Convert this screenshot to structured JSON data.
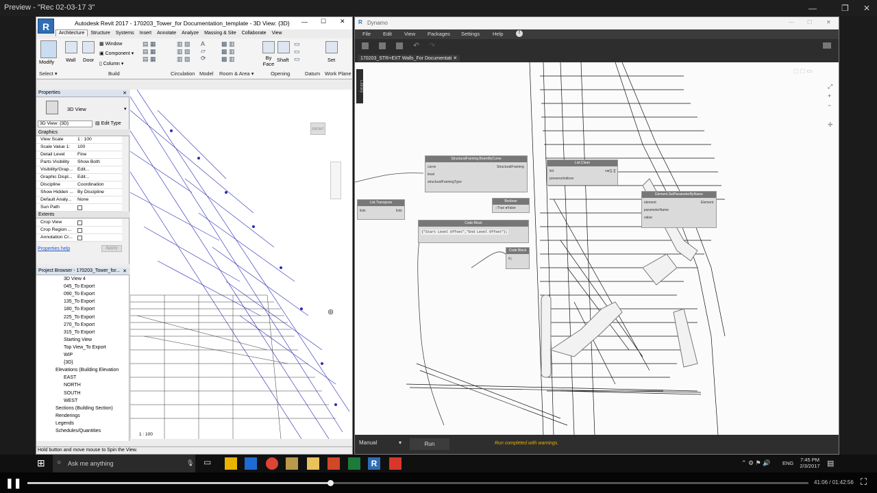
{
  "preview": {
    "title": "Preview - \"Rec 02-03-17 3\""
  },
  "revit": {
    "app_letter": "R",
    "title": "Autodesk Revit 2017 -     170203_Tower_for Documentation_template - 3D View: {3D}",
    "tabs": [
      "Architecture",
      "Structure",
      "Systems",
      "Insert",
      "Annotate",
      "Analyze",
      "Massing & Site",
      "Collaborate",
      "View"
    ],
    "ribbon": {
      "modify": "Modify",
      "wall": "Wall",
      "door": "Door",
      "window": "Window",
      "component": "Component",
      "column": "Column",
      "byface": "By Face",
      "shaft": "Shaft",
      "set": "Set",
      "workplane_icon": "",
      "groups": {
        "select": "Select ▾",
        "build": "Build",
        "circulation": "Circulation",
        "model": "Model",
        "room": "Room & Area ▾",
        "opening": "Opening",
        "datum": "Datum",
        "workplane": "Work Plane"
      }
    },
    "properties": {
      "header": "Properties",
      "type_name": "3D View",
      "view_selector": "3D View: {3D}",
      "edit_type": "Edit Type",
      "section_graphics": "Graphics",
      "rows": [
        {
          "k": "View Scale",
          "v": "1 : 100"
        },
        {
          "k": "Scale Value    1:",
          "v": "100"
        },
        {
          "k": "Detail Level",
          "v": "Fine"
        },
        {
          "k": "Parts Visibility",
          "v": "Show Both"
        },
        {
          "k": "Visibility/Grap...",
          "v": "Edit..."
        },
        {
          "k": "Graphic Displ...",
          "v": "Edit..."
        },
        {
          "k": "Discipline",
          "v": "Coordination"
        },
        {
          "k": "Show Hidden ...",
          "v": "By Discipline"
        },
        {
          "k": "Default Analy...",
          "v": "None"
        },
        {
          "k": "Sun Path",
          "v": ""
        }
      ],
      "section_extents": "Extents",
      "rows2": [
        {
          "k": "Crop View",
          "v": ""
        },
        {
          "k": "Crop Region ...",
          "v": ""
        },
        {
          "k": "Annotation Cr...",
          "v": ""
        }
      ],
      "help": "Properties help",
      "apply": "Apply"
    },
    "browser": {
      "header": "Project Browser - 170203_Tower_for...",
      "items": [
        "3D View 4",
        "045_To Export",
        "090_To Export",
        "135_To Export",
        "180_To Export",
        "225_To Export",
        "270_To Export",
        "315_To Export",
        "Starting View",
        "Top View_To Export",
        "WIP",
        "{3D}"
      ],
      "elevations": "Elevations (Building Elevation",
      "elev_items": [
        "EAST",
        "NORTH",
        "SOUTH",
        "WEST"
      ],
      "more": [
        "Sections (Building Section)",
        "Renderings",
        "Legends",
        "Schedules/Quantities"
      ]
    },
    "view": {
      "scale": "1 : 100",
      "viewcube": "FRONT"
    },
    "status": "Hold button and move mouse to Spin the View."
  },
  "dynamo": {
    "app_letter": "R",
    "title": "Dynamo",
    "menu": [
      "File",
      "Edit",
      "View",
      "Packages",
      "Settings",
      "Help"
    ],
    "tab": "170203_STR+EXT Walls_For Documentati",
    "library": "Library",
    "nodes": {
      "n1": {
        "title": "StructuralFraming.BeamByCurve",
        "inputs": [
          "curve",
          "level",
          "structuralFramingType"
        ],
        "output": "StructuralFraming"
      },
      "n2": {
        "title": "List.Clean",
        "inputs": [
          "list",
          "preserveIndices"
        ],
        "output": "var[]..[]"
      },
      "n3": {
        "title": "List.Transpose",
        "inputs": [
          "lists"
        ],
        "output": "lists"
      },
      "n4": {
        "title": "Boolean",
        "inputs": [
          "True",
          "False"
        ],
        "output": ">"
      },
      "n5": {
        "title": "Code Block",
        "code": "{\"Start Level Offset\",\"End Level Offset\"};"
      },
      "n6": {
        "title": "Code Block",
        "code": "0;"
      },
      "n7": {
        "title": "Element.SetParameterByName",
        "inputs": [
          "element",
          "parameterName",
          "value"
        ],
        "output": "Element"
      }
    },
    "run_mode": "Manual",
    "run": "Run",
    "status": "Run completed with warnings."
  },
  "taskbar": {
    "search": "Ask me anything",
    "lang": "ENG",
    "time": "7:45 PM",
    "date": "2/3/2017"
  },
  "player": {
    "time": "41:06 / 01:42:56",
    "progress": 0.388
  }
}
